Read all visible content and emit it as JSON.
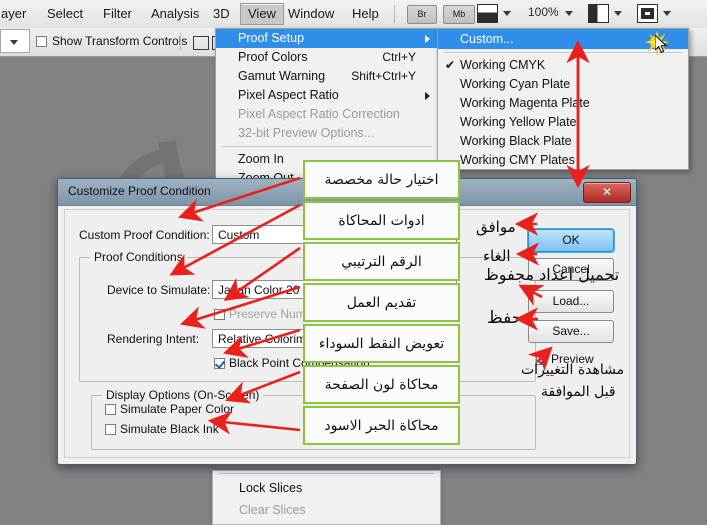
{
  "app": {
    "menubar": [
      {
        "label": "ayer",
        "active": false
      },
      {
        "label": "Select",
        "active": false
      },
      {
        "label": "Filter",
        "active": false
      },
      {
        "label": "Analysis",
        "active": false
      },
      {
        "label": "3D",
        "active": false
      },
      {
        "label": "View",
        "active": true
      },
      {
        "label": "Window",
        "active": false
      },
      {
        "label": "Help",
        "active": false
      }
    ],
    "toolbar": {
      "bridge_label": "Br",
      "minibridge_label": "Mb",
      "zoom_label": "100%",
      "screenmode_icon": "screen-mode-icon",
      "arrange_icon": "arrange-documents-icon",
      "viewextras_icon": "view-extras-icon"
    },
    "options": {
      "show_transform_controls": "Show Transform Controls",
      "show_transform_checked": false
    }
  },
  "view_menu": {
    "items": [
      {
        "label": "Proof Setup",
        "shortcut": "",
        "submenu": true,
        "highlight": true,
        "disabled": false
      },
      {
        "label": "Proof Colors",
        "shortcut": "Ctrl+Y",
        "submenu": false,
        "highlight": false,
        "disabled": false
      },
      {
        "label": "Gamut Warning",
        "shortcut": "Shift+Ctrl+Y",
        "submenu": false,
        "highlight": false,
        "disabled": false
      },
      {
        "label": "Pixel Aspect Ratio",
        "shortcut": "",
        "submenu": true,
        "highlight": false,
        "disabled": false
      },
      {
        "label": "Pixel Aspect Ratio Correction",
        "shortcut": "",
        "submenu": false,
        "highlight": false,
        "disabled": true
      },
      {
        "label": "32-bit Preview Options...",
        "shortcut": "",
        "submenu": false,
        "highlight": false,
        "disabled": true
      },
      {
        "label": "Zoom In",
        "shortcut": "",
        "submenu": false,
        "highlight": false,
        "disabled": false
      },
      {
        "label": "Zoom Out",
        "shortcut": "",
        "submenu": false,
        "highlight": false,
        "disabled": false
      }
    ]
  },
  "proof_setup_submenu": {
    "items": [
      {
        "label": "Custom...",
        "checked": false,
        "highlight": true
      },
      {
        "label": "Working CMYK",
        "checked": true,
        "highlight": false
      },
      {
        "label": "Working Cyan Plate",
        "checked": false,
        "highlight": false
      },
      {
        "label": "Working Magenta Plate",
        "checked": false,
        "highlight": false
      },
      {
        "label": "Working Yellow Plate",
        "checked": false,
        "highlight": false
      },
      {
        "label": "Working Black Plate",
        "checked": false,
        "highlight": false
      },
      {
        "label": "Working CMY Plates",
        "checked": false,
        "highlight": false
      }
    ],
    "checkmark_glyph": "✔"
  },
  "bottom_menu": {
    "items": [
      {
        "label": "Lock Slices",
        "disabled": false
      },
      {
        "label": "Clear Slices",
        "disabled": true
      }
    ]
  },
  "dialog": {
    "title": "Customize Proof Condition",
    "close_label": "✕",
    "custom_proof_condition_label": "Custom Proof Condition:",
    "custom_proof_condition_value": "Custom",
    "proof_conditions_group": "Proof Conditions",
    "device_to_simulate_label": "Device to Simulate:",
    "device_to_simulate_value": "Japan Color 20",
    "preserve_numbers_label": "Preserve Numbers",
    "preserve_numbers_checked": false,
    "rendering_intent_label": "Rendering Intent:",
    "rendering_intent_value": "Relative Colorim",
    "black_point_label": "Black Point Compensation",
    "black_point_checked": true,
    "display_options_group": "Display Options (On-Screen)",
    "simulate_paper_color_label": "Simulate Paper Color",
    "simulate_paper_color_checked": false,
    "simulate_black_ink_label": "Simulate Black Ink",
    "simulate_black_ink_checked": false,
    "buttons": {
      "ok": "OK",
      "cancel": "Cancel",
      "load": "Load...",
      "save": "Save..."
    },
    "preview_label": "Preview",
    "preview_checked": true
  },
  "annotations": {
    "boxes": [
      {
        "id": "choose-custom-state",
        "text": "اختيار حالة مخصصة"
      },
      {
        "id": "simulation-tools",
        "text": "ادوات المحاكاة"
      },
      {
        "id": "ordinal-number",
        "text": "الرقم الترتيبي"
      },
      {
        "id": "work-presentation",
        "text": "تقديم العمل"
      },
      {
        "id": "black-point-compensation",
        "text": "تعويض النقط السوداء"
      },
      {
        "id": "simulate-page-color",
        "text": "محاكاة لون الصفحة"
      },
      {
        "id": "simulate-black-ink",
        "text": "محاكاة الحبر الاسود"
      }
    ],
    "free_labels": [
      {
        "id": "ok-label",
        "text": "موافق"
      },
      {
        "id": "cancel-label",
        "text": "الغاء"
      },
      {
        "id": "load-label",
        "text": "تحميل اعداد مجفوظ"
      },
      {
        "id": "save-label",
        "text": "حفظ"
      },
      {
        "id": "preview-note-line1",
        "text": "مشاهدة التغييرات"
      },
      {
        "id": "preview-note-line2",
        "text": "قبل الموافقة"
      }
    ],
    "arrow_color": "#e8211a",
    "box_border_color": "#8cc63e"
  }
}
